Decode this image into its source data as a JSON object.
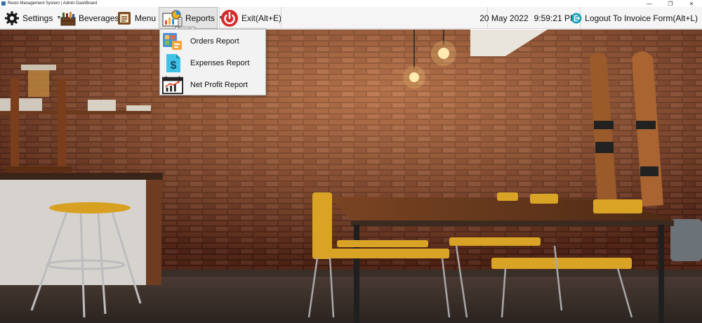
{
  "window": {
    "title": "Resto Management System  | Admin DashBoard",
    "controls": {
      "minimize": "—",
      "maximize": "❐",
      "close": "✕"
    }
  },
  "menubar": {
    "settings": {
      "label": "Settings",
      "icon": "gear-icon"
    },
    "beverages": {
      "label": "Beverages",
      "icon": "beverages-icon"
    },
    "menu": {
      "label": "Menu",
      "icon": "menu-icon"
    },
    "reports": {
      "label": "Reports",
      "icon": "reports-icon",
      "tooltip": "Reports"
    },
    "exit": {
      "label": "Exit(Alt+E)",
      "icon": "power-icon"
    },
    "date": "20 May 2022",
    "time": "9:59:21 PM",
    "logout": {
      "label": "Logout To Invoice Form(Alt+L)",
      "icon": "logout-icon"
    }
  },
  "reports_dropdown": {
    "items": [
      {
        "label": "Orders Report",
        "icon": "orders-report-icon"
      },
      {
        "label": "Expenses Report",
        "icon": "expenses-report-icon"
      },
      {
        "label": "Net Profit Report",
        "icon": "net-profit-report-icon"
      }
    ]
  },
  "colors": {
    "menubar_bg": "#f5f5f5",
    "dropdown_bg": "#f2f2f2",
    "exit_red": "#d62b2b",
    "logout_teal": "#1aa0b8",
    "brick": "#8a3b26",
    "chair_yellow": "#d9a425"
  }
}
